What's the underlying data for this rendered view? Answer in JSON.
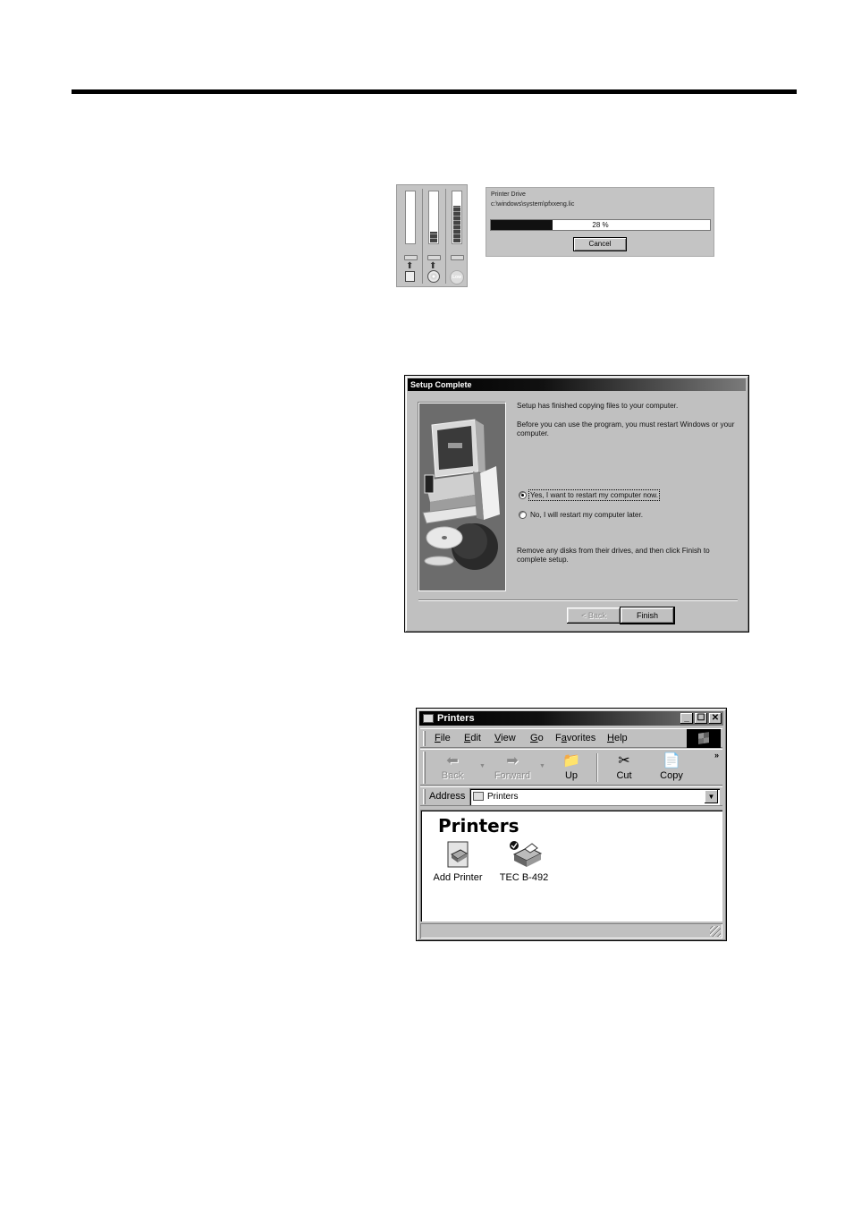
{
  "install_progress": {
    "gauges": [
      {
        "name": "gauge-1",
        "fill_fraction": 0.0,
        "icon": "document-upload-icon"
      },
      {
        "name": "gauge-2",
        "fill_fraction": 0.2,
        "icon": "cd-install-icon"
      },
      {
        "name": "gauge-3",
        "fill_fraction": 0.7,
        "icon": "low-disk-icon",
        "icon_label": "Low"
      }
    ],
    "title": "Printer Drive",
    "file_path": "c:\\windows\\system\\pfxxeng.lic",
    "progress_percent": 28,
    "progress_label": "28 %",
    "cancel_label": "Cancel"
  },
  "setup_complete": {
    "title": "Setup Complete",
    "line1": "Setup has finished copying files to your computer.",
    "line2": "Before you can use the program, you must restart Windows or your computer.",
    "options": [
      {
        "label": "Yes, I want to restart my computer now.",
        "selected": true
      },
      {
        "label": "No, I will restart my computer later.",
        "selected": false
      }
    ],
    "line3": "Remove any disks from their drives, and then click Finish to complete setup.",
    "back_label": "< Back",
    "finish_label": "Finish"
  },
  "printers_window": {
    "title": "Printers",
    "menu": [
      {
        "key": "F",
        "rest": "ile"
      },
      {
        "key": "E",
        "rest": "dit"
      },
      {
        "key": "V",
        "rest": "iew"
      },
      {
        "key": "G",
        "rest": "o"
      },
      {
        "pre": "F",
        "key": "a",
        "rest": "vorites"
      },
      {
        "key": "H",
        "rest": "elp"
      }
    ],
    "toolbar": {
      "back": "Back",
      "forward": "Forward",
      "up": "Up",
      "cut": "Cut",
      "copy": "Copy",
      "more": "»"
    },
    "address_label": "Address",
    "address_value": "Printers",
    "folder_heading": "Printers",
    "items": [
      {
        "label": "Add Printer",
        "icon": "add-printer-icon"
      },
      {
        "label": "TEC B-492",
        "icon": "default-printer-icon",
        "default": true
      }
    ]
  }
}
